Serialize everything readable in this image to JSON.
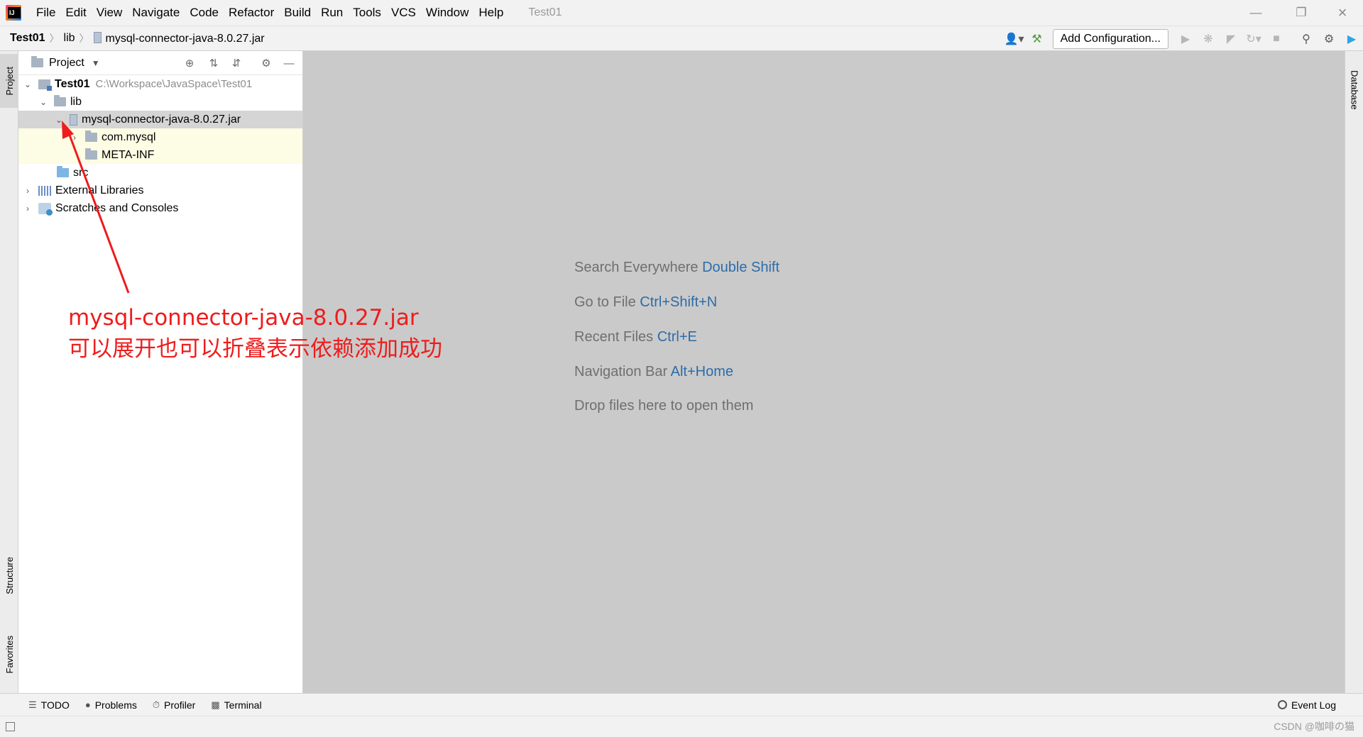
{
  "menubar": {
    "items": [
      "File",
      "Edit",
      "View",
      "Navigate",
      "Code",
      "Refactor",
      "Build",
      "Run",
      "Tools",
      "VCS",
      "Window",
      "Help"
    ],
    "window_title": "Test01"
  },
  "breadcrumb": {
    "project": "Test01",
    "folder": "lib",
    "file": "mysql-connector-java-8.0.27.jar"
  },
  "toolbar": {
    "add_configuration": "Add Configuration..."
  },
  "left_strip": {
    "project": "Project",
    "structure": "Structure",
    "favorites": "Favorites"
  },
  "right_strip": {
    "database": "Database"
  },
  "project_panel": {
    "title": "Project",
    "tree": {
      "root_name": "Test01",
      "root_path": "C:\\Workspace\\JavaSpace\\Test01",
      "lib": "lib",
      "jar": "mysql-connector-java-8.0.27.jar",
      "com_mysql": "com.mysql",
      "meta_inf": "META-INF",
      "src": "src",
      "external_libraries": "External Libraries",
      "scratches": "Scratches and Consoles"
    }
  },
  "editor": {
    "hints": [
      {
        "text": "Search Everywhere",
        "key": "Double Shift"
      },
      {
        "text": "Go to File",
        "key": "Ctrl+Shift+N"
      },
      {
        "text": "Recent Files",
        "key": "Ctrl+E"
      },
      {
        "text": "Navigation Bar",
        "key": "Alt+Home"
      },
      {
        "text": "Drop files here to open them",
        "key": ""
      }
    ]
  },
  "annotation": {
    "line1": "mysql-connector-java-8.0.27.jar",
    "line2": "可以展开也可以折叠表示依赖添加成功",
    "color": "#ee1c1c"
  },
  "bottom_bar": {
    "todo": "TODO",
    "problems": "Problems",
    "profiler": "Profiler",
    "terminal": "Terminal",
    "event_log": "Event Log"
  },
  "status_bar": {
    "watermark": "CSDN @咖啡の猫"
  }
}
